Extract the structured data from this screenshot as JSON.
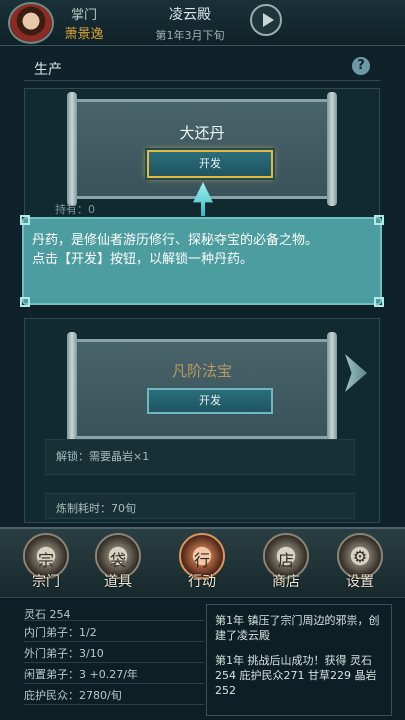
{
  "header": {
    "role": "掌门",
    "name": "萧景逸",
    "sect_name": "凌云殿",
    "date": "第1年3月下旬"
  },
  "section": {
    "title": "生产"
  },
  "cards": [
    {
      "title": "大还丹",
      "button": "开发",
      "peek": "持有：0"
    },
    {
      "title": "凡阶法宝",
      "button": "开发",
      "requirement": "解锁：需要晶岩×1",
      "time": "炼制耗时：70旬"
    }
  ],
  "tooltip": {
    "line1": "丹药，是修仙者游历修行、探秘夺宝的必备之物。",
    "line2": "点击【开发】按钮，以解锁一种丹药。"
  },
  "nav": [
    {
      "label": "宗门",
      "icon": "sect-icon",
      "glyph": "宗"
    },
    {
      "label": "道具",
      "icon": "bag-icon",
      "glyph": "袋"
    },
    {
      "label": "行动",
      "icon": "action-icon",
      "glyph": "行"
    },
    {
      "label": "商店",
      "icon": "shop-icon",
      "glyph": "店"
    },
    {
      "label": "设置",
      "icon": "gear-icon",
      "glyph": "⚙"
    }
  ],
  "stats": [
    "灵石 254",
    "内门弟子：1/2",
    "外门弟子：3/10",
    "闲置弟子：3  +0.27/年",
    "庇护民众：2780/旬"
  ],
  "log": [
    "第1年 镇压了宗门周边的邪祟，创建了凌云殿",
    "第1年 挑战后山成功！获得 灵石254 庇护民众271 甘草229 晶岩252"
  ]
}
